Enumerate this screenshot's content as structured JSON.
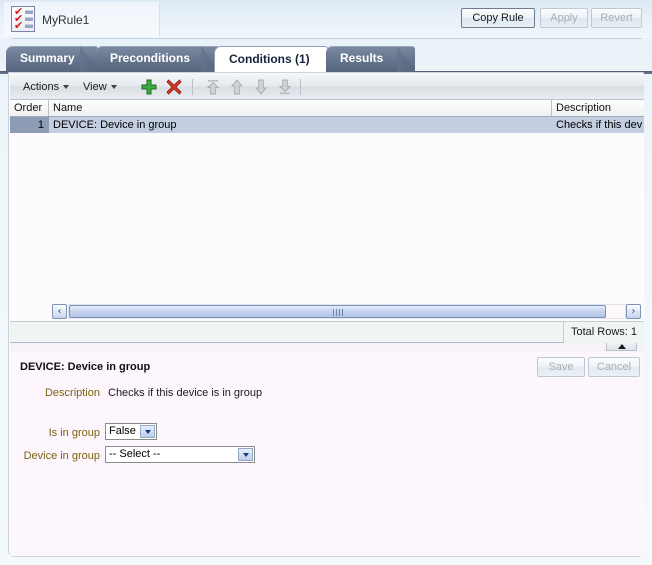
{
  "window": {
    "title": "MyRule1",
    "icon": "rule-checklist-icon"
  },
  "header": {
    "buttons": [
      {
        "label": "Copy Rule",
        "state": "enabled"
      },
      {
        "label": "Apply",
        "state": "disabled"
      },
      {
        "label": "Revert",
        "state": "disabled"
      }
    ]
  },
  "tabs": [
    {
      "label": "Summary",
      "active": false
    },
    {
      "label": "Preconditions",
      "active": false
    },
    {
      "label": "Conditions (1)",
      "active": true
    },
    {
      "label": "Results",
      "active": false
    }
  ],
  "toolbar": {
    "actions_label": "Actions",
    "view_label": "View",
    "icons": [
      {
        "name": "add-icon",
        "state": "enabled"
      },
      {
        "name": "delete-icon",
        "state": "enabled"
      },
      {
        "name": "move-to-top-icon",
        "state": "disabled"
      },
      {
        "name": "move-up-icon",
        "state": "disabled"
      },
      {
        "name": "move-down-icon",
        "state": "disabled"
      },
      {
        "name": "move-to-bottom-icon",
        "state": "disabled"
      }
    ]
  },
  "table": {
    "columns": [
      "Order",
      "Name",
      "Description"
    ],
    "rows": [
      {
        "order": "1",
        "name": "DEVICE: Device in group",
        "description": "Checks if this dev",
        "selected": true
      }
    ],
    "status": "Total Rows: 1",
    "scrollbar": {
      "left_arrow": "‹",
      "right_arrow": "›"
    }
  },
  "detail": {
    "title": "DEVICE: Device in group",
    "buttons": [
      {
        "label": "Save",
        "state": "disabled"
      },
      {
        "label": "Cancel",
        "state": "disabled"
      }
    ],
    "fields": [
      {
        "label": "Description",
        "value": "Checks if this device is in group",
        "type": "static"
      },
      {
        "label": "Is in group",
        "value": "False",
        "type": "select"
      },
      {
        "label": "Device in group",
        "value": "-- Select --",
        "type": "select"
      }
    ]
  },
  "colors": {
    "tab_active_bg": "#ffffff",
    "tab_inactive_bg": "#6b7a92",
    "row_selected_bg": "#c3cee1",
    "order_cell_bg": "#8d9bb5",
    "label_text": "#7a6111",
    "panel_bg": "#fdf7fd",
    "page_bg": "#eff6fb",
    "add_icon": "#2f9e2f",
    "delete_icon": "#d02a1e"
  }
}
